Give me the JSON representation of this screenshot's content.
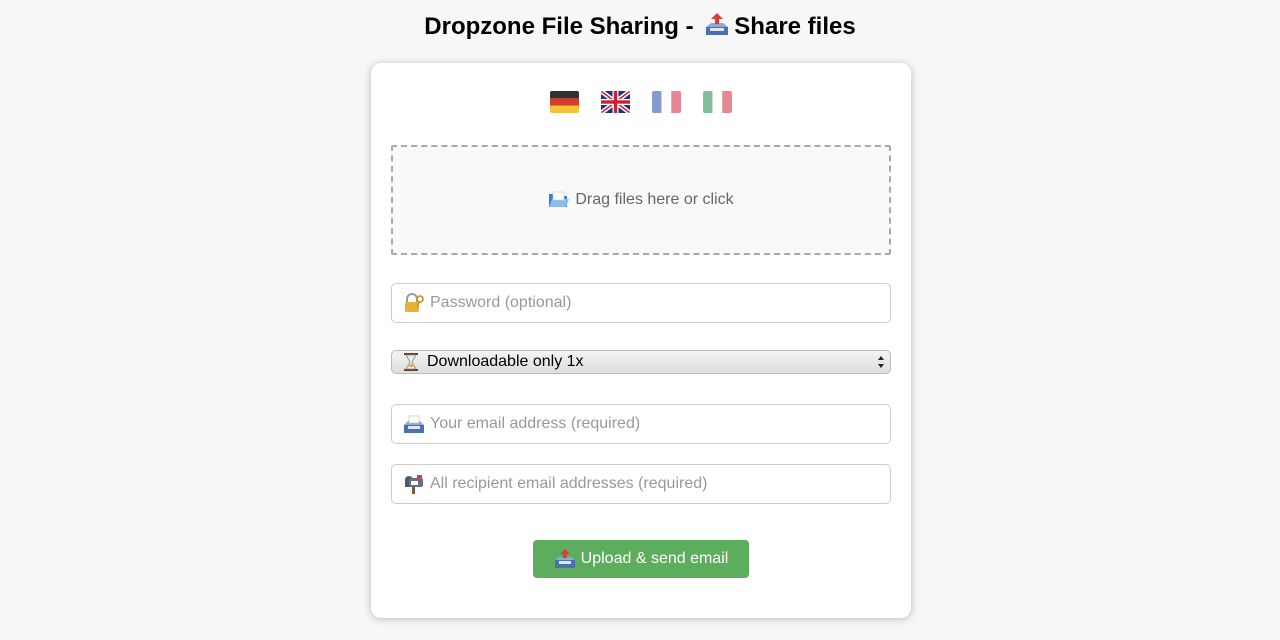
{
  "page": {
    "title": "Dropzone File Sharing - ",
    "title_suffix": "Share files"
  },
  "languages": [
    {
      "code": "de",
      "label": "German",
      "active": true
    },
    {
      "code": "en",
      "label": "English",
      "active": true
    },
    {
      "code": "fr",
      "label": "French",
      "active": false
    },
    {
      "code": "it",
      "label": "Italian",
      "active": false
    }
  ],
  "dropzone": {
    "label": "Drag files here or click",
    "icon": "open-folder-icon"
  },
  "password": {
    "placeholder": "Password (optional)",
    "value": "",
    "icon": "lock-key-icon"
  },
  "expiry": {
    "selected": "Downloadable only 1x",
    "icon": "hourglass-icon"
  },
  "sender_email": {
    "placeholder": "Your email address (required)",
    "value": "",
    "icon": "inbox-tray-icon"
  },
  "recipients": {
    "placeholder": "All recipient email addresses (required)",
    "value": "",
    "icon": "mailbox-icon"
  },
  "submit": {
    "label": "Upload & send email",
    "icon": "outbox-tray-icon"
  },
  "colors": {
    "accent_green": "#5cad5c",
    "background": "#f7f7f7",
    "card": "#ffffff"
  }
}
